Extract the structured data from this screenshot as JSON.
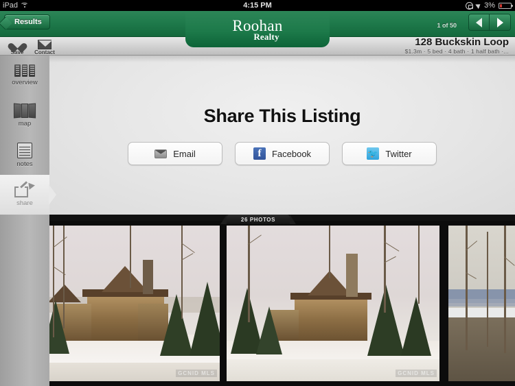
{
  "status_bar": {
    "carrier": "iPad",
    "wifi_icon": "wifi-icon",
    "time": "4:15 PM",
    "rotation_lock_icon": "rotation-lock-icon",
    "location_icon": "location-arrow-icon",
    "battery_percent": "3%",
    "battery_icon": "battery-icon"
  },
  "navbar": {
    "back_label": "Results",
    "logo_line1": "Roohan",
    "logo_line2": "Realty",
    "counter": "1 of 50",
    "prev_icon": "chevron-left-icon",
    "next_icon": "chevron-right-icon"
  },
  "subbar": {
    "save_label": "Save",
    "save_icon": "heart-icon",
    "contact_label": "Contact",
    "contact_icon": "envelope-icon",
    "address": "128 Buckskin Loop",
    "details": "$1.3m  ·  5 bed  ·  4 bath  ·  1 half bath  ·..."
  },
  "sidebar": {
    "items": [
      {
        "label": "overview",
        "icon": "columns-icon",
        "active": false
      },
      {
        "label": "map",
        "icon": "map-icon",
        "active": false
      },
      {
        "label": "notes",
        "icon": "notepad-icon",
        "active": false
      },
      {
        "label": "share",
        "icon": "share-arrow-icon",
        "active": true
      }
    ]
  },
  "main": {
    "title": "Share This Listing",
    "buttons": [
      {
        "label": "Email",
        "icon": "mail-icon"
      },
      {
        "label": "Facebook",
        "icon": "facebook-icon",
        "glyph": "f"
      },
      {
        "label": "Twitter",
        "icon": "twitter-bird-icon"
      }
    ]
  },
  "photo_strip": {
    "tab_label": "26 PHOTOS",
    "photos": [
      {
        "watermark": "GCNID MLS",
        "alt": "exterior front of timber-frame home in snow"
      },
      {
        "watermark": "GCNID MLS",
        "alt": "exterior side of home with stone chimney in snow"
      },
      {
        "watermark": "",
        "alt": "view of lake and mountains through bare trees"
      }
    ]
  },
  "colors": {
    "brand_green": "#1d7a4a",
    "brand_green_dark": "#0d6438",
    "facebook_blue": "#32549a",
    "twitter_blue": "#2fa3dd",
    "battery_red": "#d03a32"
  }
}
